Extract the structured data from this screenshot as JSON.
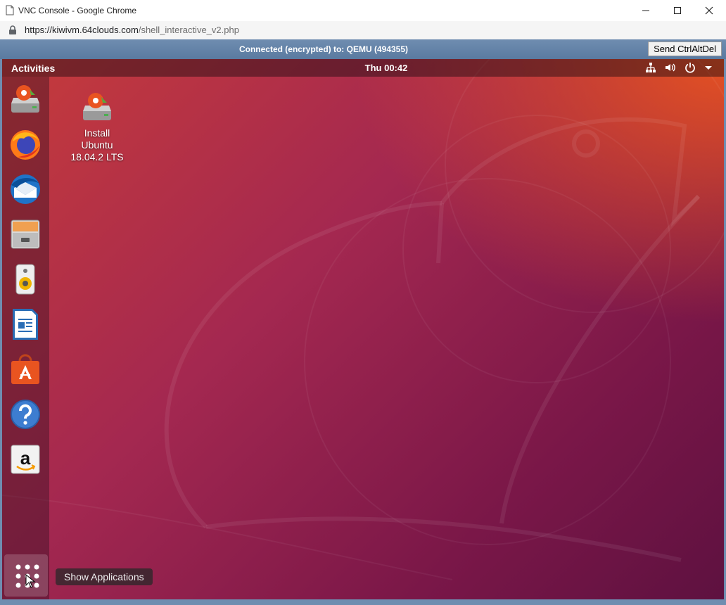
{
  "window": {
    "title": "VNC Console - Google Chrome",
    "url_host": "https://kiwivm.64clouds.com",
    "url_path": "/shell_interactive_v2.php"
  },
  "vnc": {
    "status": "Connected (encrypted) to: QEMU (494355)",
    "send_button": "Send CtrlAltDel"
  },
  "ubuntu": {
    "activities": "Activities",
    "clock": "Thu 00:42",
    "tray_icons": [
      "network-icon",
      "volume-icon",
      "power-icon",
      "chevron-down-icon"
    ],
    "dock_items": [
      "install-ubuntu-icon",
      "firefox-icon",
      "thunderbird-icon",
      "files-icon",
      "rhythmbox-icon",
      "libreoffice-writer-icon",
      "ubuntu-software-icon",
      "help-icon",
      "amazon-icon"
    ],
    "show_apps_tooltip": "Show Applications",
    "desktop_icon": {
      "line1": "Install",
      "line2": "Ubuntu",
      "line3": "18.04.2 LTS"
    }
  },
  "colors": {
    "ubuntu_orange": "#e95420",
    "aubergine": "#77216f",
    "vnc_bar": "#6f8db0"
  }
}
